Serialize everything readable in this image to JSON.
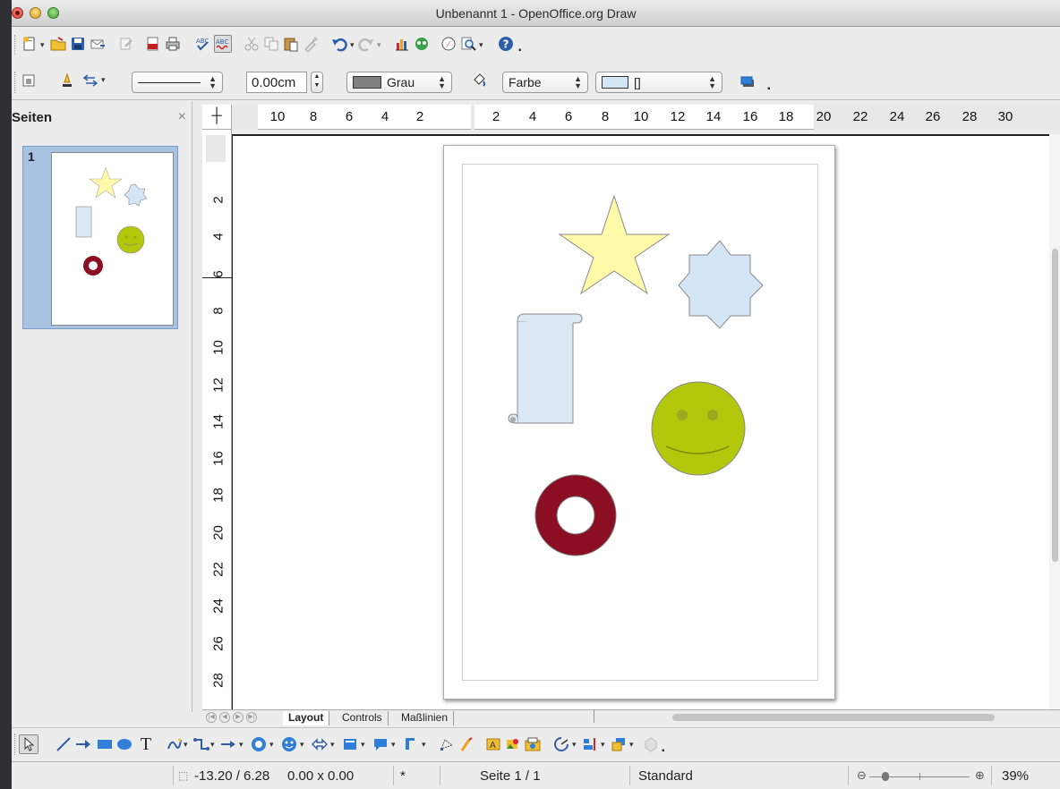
{
  "window": {
    "title": "Unbenannt 1 - OpenOffice.org Draw"
  },
  "toolbar_line": {
    "width_value": "0.00cm",
    "area_color": "Grau",
    "area_color_swatch": "#808080",
    "area_style": "Farbe",
    "shadow_value": "[]"
  },
  "sidebar": {
    "title": "Seiten",
    "close_glyph": "×",
    "page_number": "1"
  },
  "ruler": {
    "horizontal_ticks": [
      "10",
      "8",
      "6",
      "4",
      "2",
      "2",
      "4",
      "6",
      "8",
      "10",
      "12",
      "14",
      "16",
      "18",
      "20",
      "22",
      "24",
      "26",
      "28",
      "30"
    ],
    "vertical_ticks": [
      "2",
      "4",
      "6",
      "8",
      "10",
      "12",
      "14",
      "16",
      "18",
      "20",
      "22",
      "24",
      "26",
      "28"
    ]
  },
  "tabs": [
    {
      "label": "Layout",
      "active": true
    },
    {
      "label": "Controls",
      "active": false
    },
    {
      "label": "Maßlinien",
      "active": false
    }
  ],
  "shapes": {
    "star_color": "#fffaaa",
    "octagram_color": "#d4e5f5",
    "scroll_color": "#dce9f5",
    "smiley_color": "#b3c80a",
    "ring_color": "#8b0e23"
  },
  "statusbar": {
    "position": "-13.20 / 6.28",
    "size": "0.00 x 0.00",
    "modified": "*",
    "page": "Seite 1 / 1",
    "layout": "Standard",
    "zoom": "39%"
  }
}
